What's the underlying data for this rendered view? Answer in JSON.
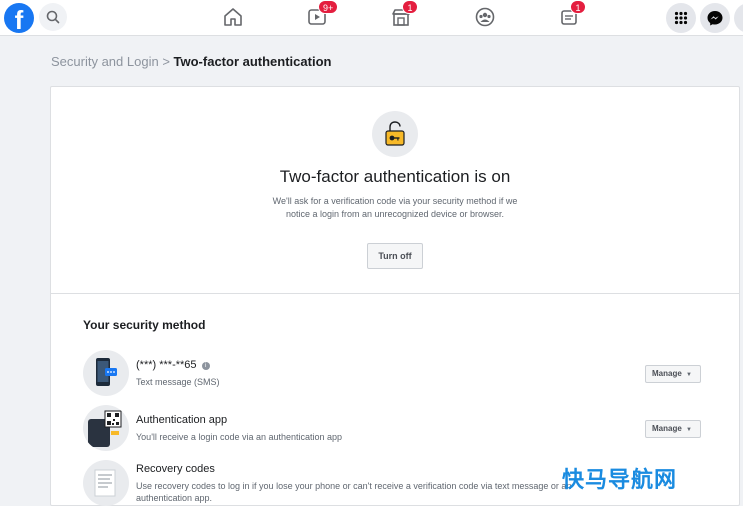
{
  "topbar": {
    "logo_letter": "f",
    "icons": {
      "search": "search-icon",
      "home": "home-icon",
      "watch": "video-icon",
      "marketplace": "marketplace-icon",
      "groups": "groups-icon",
      "gaming": "gaming-icon",
      "menu": "grid-menu-icon",
      "messenger": "messenger-icon"
    },
    "watch_badge": "9+",
    "marketplace_badge": "1",
    "gaming_badge": "1"
  },
  "breadcrumb": {
    "parent": "Security and Login",
    "separator": ">",
    "current": "Two-factor authentication"
  },
  "status": {
    "icon": "lock-open-icon",
    "title": "Two-factor authentication is on",
    "description": "We'll ask for a verification code via your security method if we notice a login from an unrecognized device or browser.",
    "turn_off_label": "Turn off"
  },
  "security": {
    "section_title": "Your security method",
    "methods": [
      {
        "icon": "phone-icon",
        "name": "(***) ***-**65",
        "info_icon": "info-icon",
        "desc": "Text message (SMS)",
        "action": "Manage"
      },
      {
        "icon": "qr-code-icon",
        "name": "Authentication app",
        "desc": "You'll receive a login code via an authentication app",
        "action": "Manage"
      },
      {
        "icon": "document-icon",
        "name": "Recovery codes",
        "desc": "Use recovery codes to log in if you lose your phone or can't receive a verification code via text message or an authentication app."
      }
    ]
  },
  "watermark": "快马导航网",
  "colors": {
    "brand": "#1877f2",
    "badge": "#e41e3f",
    "lock": "#f7b928"
  }
}
